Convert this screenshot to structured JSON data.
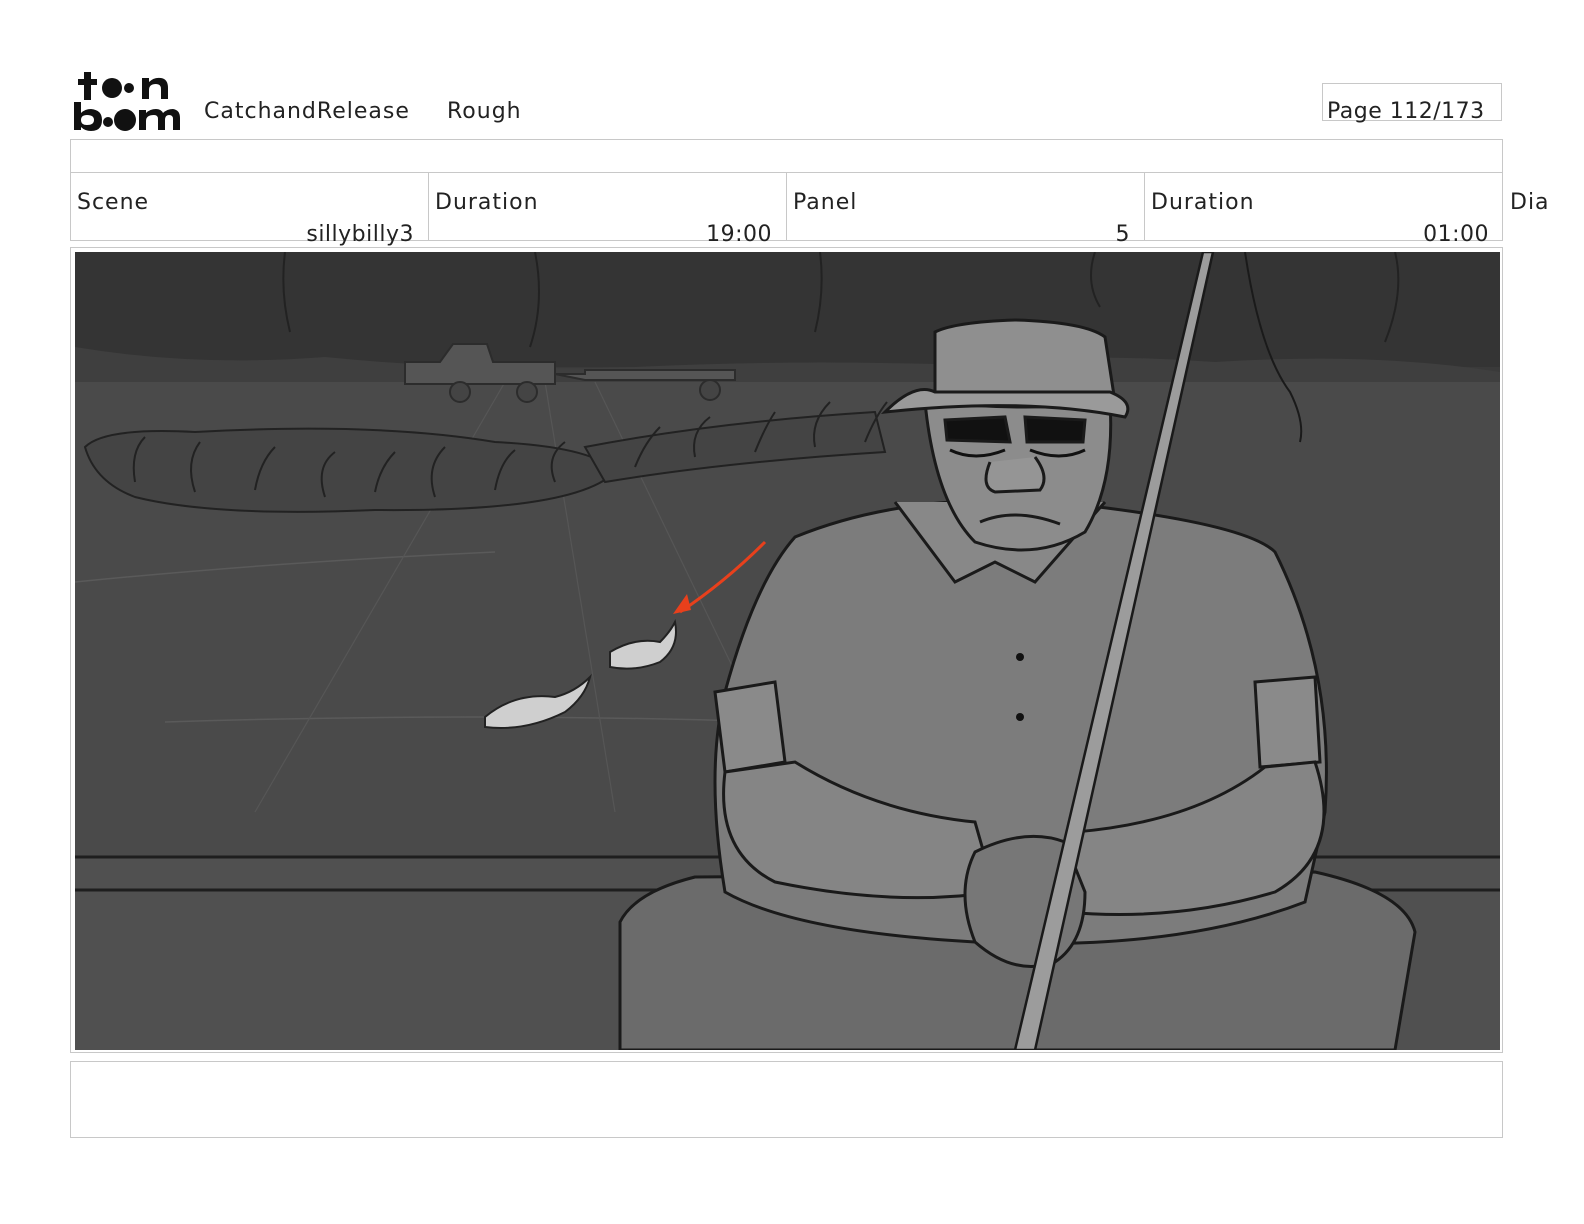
{
  "header": {
    "logo_text": "toonboom",
    "project": "CatchandRelease",
    "stage": "Rough",
    "page": "Page 112/173"
  },
  "info": {
    "scene_label": "Scene",
    "scene_value": "sillybilly3",
    "scene_duration_label": "Duration",
    "scene_duration_value": "19:00",
    "panel_label": "Panel",
    "panel_value": "5",
    "panel_duration_label": "Duration",
    "panel_duration_value": "01:00",
    "dialogue_label": "Dia"
  },
  "panel": {
    "icons": [
      "pickup-truck-icon",
      "trailer-icon",
      "fish-icon",
      "arrow-icon",
      "fishing-rod-icon",
      "bucket-hat-icon"
    ],
    "accent_color": "#e8401c"
  }
}
